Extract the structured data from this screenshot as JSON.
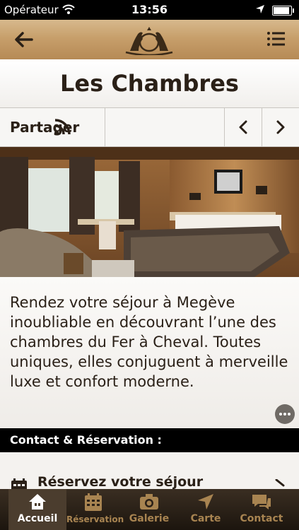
{
  "status_bar": {
    "carrier": "Opérateur",
    "time": "13:56",
    "battery_level": 0.9
  },
  "page": {
    "title": "Les Chambres"
  },
  "toolbar": {
    "share_label": "Partager"
  },
  "description": "Rendez votre séjour à Megève inoubliable en découvrant l’une des chambres du Fer à Cheval. Toutes uniques, elles conjuguent à merveille luxe et confort moderne.",
  "section": {
    "header": "Contact & Réservation :"
  },
  "rows": [
    {
      "label": "Réservez votre séjour",
      "icon": "calendar-icon"
    }
  ],
  "tabs": [
    {
      "label": "Accueil",
      "icon": "home-icon",
      "active": true
    },
    {
      "label": "Réservation",
      "icon": "calendar-icon",
      "active": false
    },
    {
      "label": "Galerie",
      "icon": "camera-icon",
      "active": false
    },
    {
      "label": "Carte",
      "icon": "location-arrow-icon",
      "active": false
    },
    {
      "label": "Contact",
      "icon": "chat-icon",
      "active": false
    }
  ],
  "colors": {
    "brand_gold": "#c79f6b",
    "tab_inactive": "#a88451",
    "text_dark": "#2a2017"
  }
}
